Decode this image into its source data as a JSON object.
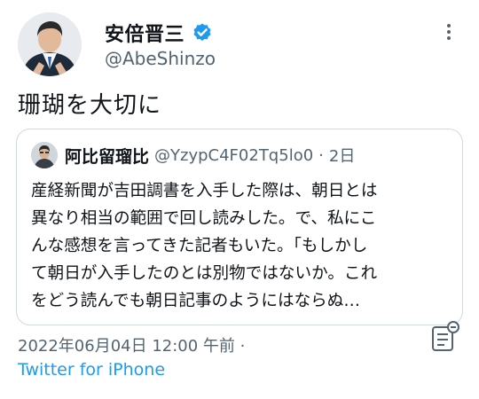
{
  "author": {
    "display_name": "安倍晋三",
    "handle": "@AbeShinzo",
    "verified": true,
    "avatar_icon": "person-in-suit-avatar"
  },
  "tweet": {
    "text": "珊瑚を大切に"
  },
  "quoted_tweet": {
    "display_name": "阿比留瑠比",
    "handle": "@YzypC4F02Tq5lo0",
    "separator": "·",
    "age": "2日",
    "lines": [
      "産経新聞が吉田調書を入手した際は、朝日とは",
      "異なり相当の範囲で回し読みした。で、私にこ",
      "んな感想を言ってきた記者もいた。「もしかし",
      "て朝日が入手したのとは別物ではないか。これ",
      "をどう読んでも朝日記事のようにはならぬ…"
    ]
  },
  "meta": {
    "timestamp": "2022年06月04日 12:00 午前 ·",
    "source": "Twitter for iPhone"
  },
  "colors": {
    "accent": "#1d9bf0",
    "secondary_text": "#536471",
    "border": "#cfd9de"
  }
}
